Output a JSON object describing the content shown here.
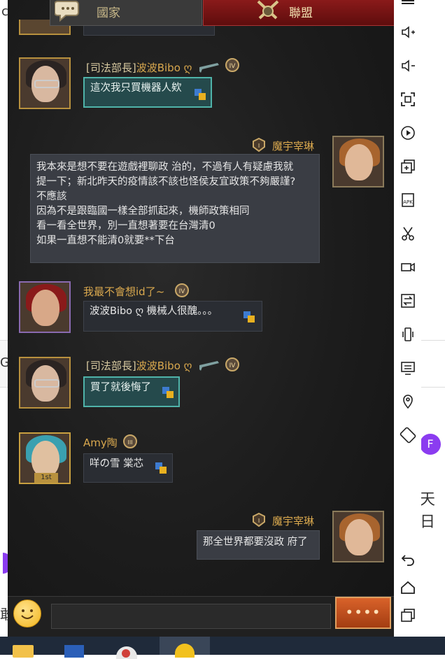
{
  "tabs": {
    "country": "國家",
    "alliance": "聯盟"
  },
  "messages": [
    {
      "side": "left",
      "rank": "[司法部長]",
      "name": "波波Bibo ღ",
      "text": [
        "這次我只買機器人欸"
      ],
      "style": "teal"
    },
    {
      "side": "right",
      "rank": "",
      "name": "魔宇宰琳",
      "text": [
        "我本來是想不要在遊戲裡聊政 治的，不過有人有疑慮我就",
        "提一下；新北昨天的疫情該不該也怪侯友宜政策不夠嚴謹?",
        "不應該",
        "因為不是跟臨國一樣全部抓起來，機師政策相同",
        "看一看全世界，別一直想著要在台灣清0",
        "如果一直想不能清0就要**下台"
      ],
      "style": "me"
    },
    {
      "side": "left",
      "rank": "",
      "name": "我最不會想id了~",
      "text": [
        "波波Bibo ღ 機械人很醜。。。"
      ],
      "style": "normal"
    },
    {
      "side": "left",
      "rank": "[司法部長]",
      "name": "波波Bibo ღ",
      "text": [
        "買了就後悔了"
      ],
      "style": "teal"
    },
    {
      "side": "left",
      "rank": "",
      "name": "Amy陶",
      "text": [
        "咩の雪 棠芯"
      ],
      "style": "normal"
    },
    {
      "side": "right",
      "rank": "",
      "name": "魔宇宰琳",
      "text": [
        "那全世界都要沒政 府了"
      ],
      "style": "me"
    }
  ],
  "input": {
    "send_label": "••••"
  },
  "background": {
    "left_fragment_1": "c",
    "left_fragment_2": "G",
    "left_fragment_3": "敢",
    "right_fragment": "天日",
    "right_avatar_letter": "F"
  },
  "colors": {
    "accent_gold": "#d9a84e",
    "teal_border": "#4fb3a9",
    "alliance_tab": "#8a1a1a"
  }
}
